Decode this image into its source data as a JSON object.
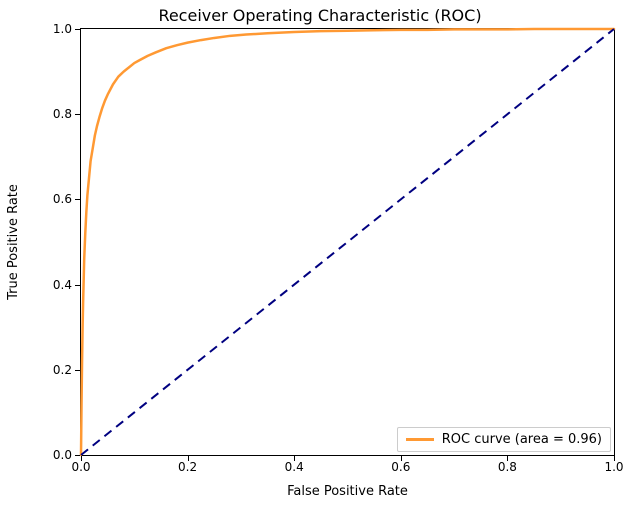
{
  "chart_data": {
    "type": "line",
    "title": "Receiver Operating Characteristic (ROC)",
    "xlabel": "False Positive Rate",
    "ylabel": "True Positive Rate",
    "xlim": [
      0.0,
      1.0
    ],
    "ylim": [
      0.0,
      1.0
    ],
    "xticks": [
      0.0,
      0.2,
      0.4,
      0.6,
      0.8,
      1.0
    ],
    "yticks": [
      0.0,
      0.2,
      0.4,
      0.6,
      0.8,
      1.0
    ],
    "legend_position": "lower right",
    "series": [
      {
        "name": "ROC curve (area = 0.96)",
        "color": "#ff9933",
        "style": "solid",
        "linewidth": 2.5,
        "x": [
          0.0,
          0.001,
          0.002,
          0.003,
          0.004,
          0.005,
          0.006,
          0.008,
          0.01,
          0.012,
          0.015,
          0.018,
          0.022,
          0.026,
          0.03,
          0.035,
          0.04,
          0.045,
          0.05,
          0.06,
          0.07,
          0.08,
          0.09,
          0.1,
          0.11,
          0.125,
          0.14,
          0.16,
          0.18,
          0.2,
          0.225,
          0.25,
          0.28,
          0.31,
          0.35,
          0.4,
          0.45,
          0.5,
          0.55,
          0.6,
          0.65,
          0.7,
          0.75,
          0.8,
          0.85,
          0.9,
          0.95,
          1.0
        ],
        "y": [
          0.0,
          0.12,
          0.22,
          0.3,
          0.36,
          0.41,
          0.46,
          0.52,
          0.57,
          0.61,
          0.65,
          0.69,
          0.72,
          0.75,
          0.772,
          0.795,
          0.815,
          0.832,
          0.846,
          0.87,
          0.888,
          0.9,
          0.91,
          0.92,
          0.927,
          0.937,
          0.945,
          0.955,
          0.962,
          0.968,
          0.974,
          0.979,
          0.984,
          0.987,
          0.99,
          0.993,
          0.995,
          0.996,
          0.997,
          0.998,
          0.998,
          0.999,
          0.999,
          0.999,
          1.0,
          1.0,
          1.0,
          1.0
        ]
      },
      {
        "name": "diagonal",
        "color": "#000080",
        "style": "dashed",
        "linewidth": 2,
        "x": [
          0.0,
          1.0
        ],
        "y": [
          0.0,
          1.0
        ]
      }
    ]
  }
}
